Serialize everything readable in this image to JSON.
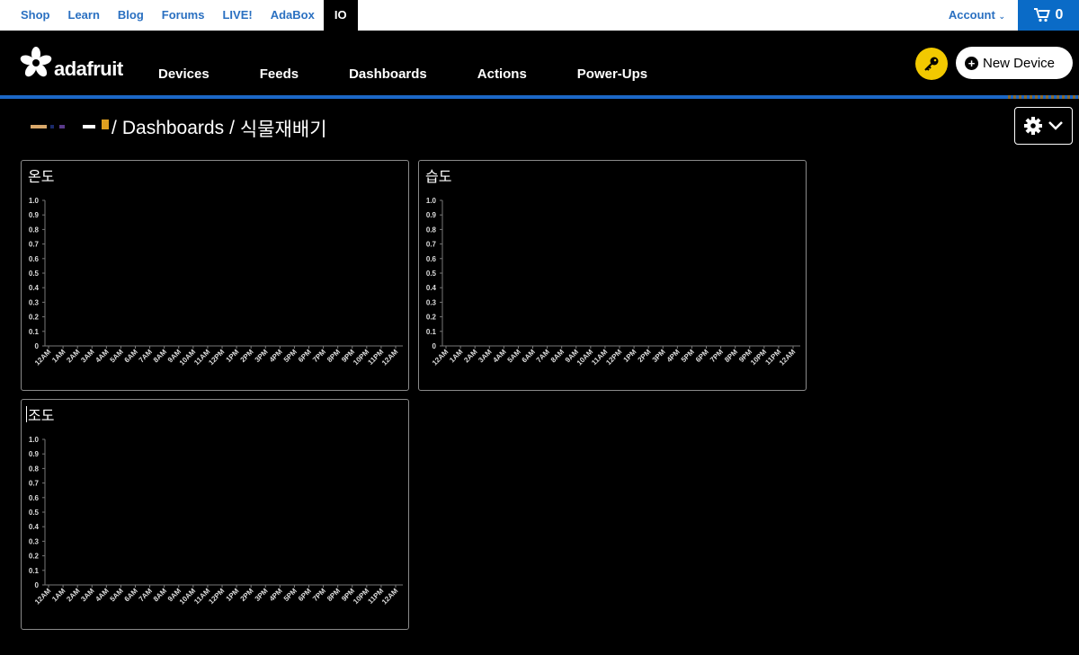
{
  "topbar": {
    "links": [
      "Shop",
      "Learn",
      "Blog",
      "Forums",
      "LIVE!",
      "AdaBox",
      "IO"
    ],
    "account": "Account",
    "cart_count": "0"
  },
  "nav": {
    "logo_text": "adafruit",
    "items": [
      "Devices",
      "Feeds",
      "Dashboards",
      "Actions",
      "Power-Ups"
    ],
    "new_device": "New Device"
  },
  "breadcrumb": {
    "separator": "/",
    "section": "Dashboards",
    "dashboard": "식물재배기"
  },
  "colors": {
    "link_blue": "#2a70c1",
    "cart_blue": "#0a6bc7",
    "nav_bar_blue": "#1c67c6",
    "key_yellow": "#f2c900"
  },
  "icons": {
    "cart": "cart-icon",
    "logo": "adafruit-flower-logo",
    "key": "key-icon",
    "new_device": "plus-circle-icon",
    "settings": "gear-icon",
    "settings_menu": "chevron-down-icon"
  },
  "panels": [
    {
      "title": "온도"
    },
    {
      "title": "습도"
    },
    {
      "title": "조도"
    }
  ],
  "chart_data": [
    {
      "type": "line",
      "title": "온도",
      "ylim": [
        0,
        1
      ],
      "y_ticks": [
        "0",
        "0.1",
        "0.2",
        "0.3",
        "0.4",
        "0.5",
        "0.6",
        "0.7",
        "0.8",
        "0.9",
        "1.0"
      ],
      "x_ticks": [
        "12AM",
        "1AM",
        "2AM",
        "3AM",
        "4AM",
        "5AM",
        "6AM",
        "7AM",
        "8AM",
        "9AM",
        "10AM",
        "11AM",
        "12PM",
        "1PM",
        "2PM",
        "3PM",
        "4PM",
        "5PM",
        "6PM",
        "7PM",
        "8PM",
        "9PM",
        "10PM",
        "11PM",
        "12AM"
      ],
      "series": []
    },
    {
      "type": "line",
      "title": "습도",
      "ylim": [
        0,
        1
      ],
      "y_ticks": [
        "0",
        "0.1",
        "0.2",
        "0.3",
        "0.4",
        "0.5",
        "0.6",
        "0.7",
        "0.8",
        "0.9",
        "1.0"
      ],
      "x_ticks": [
        "12AM",
        "1AM",
        "2AM",
        "3AM",
        "4AM",
        "5AM",
        "6AM",
        "7AM",
        "8AM",
        "9AM",
        "10AM",
        "11AM",
        "12PM",
        "1PM",
        "2PM",
        "3PM",
        "4PM",
        "5PM",
        "6PM",
        "7PM",
        "8PM",
        "9PM",
        "10PM",
        "11PM",
        "12AM"
      ],
      "series": []
    },
    {
      "type": "line",
      "title": "조도",
      "ylim": [
        0,
        1
      ],
      "y_ticks": [
        "0",
        "0.1",
        "0.2",
        "0.3",
        "0.4",
        "0.5",
        "0.6",
        "0.7",
        "0.8",
        "0.9",
        "1.0"
      ],
      "x_ticks": [
        "12AM",
        "1AM",
        "2AM",
        "3AM",
        "4AM",
        "5AM",
        "6AM",
        "7AM",
        "8AM",
        "9AM",
        "10AM",
        "11AM",
        "12PM",
        "1PM",
        "2PM",
        "3PM",
        "4PM",
        "5PM",
        "6PM",
        "7PM",
        "8PM",
        "9PM",
        "10PM",
        "11PM",
        "12AM"
      ],
      "series": []
    }
  ]
}
